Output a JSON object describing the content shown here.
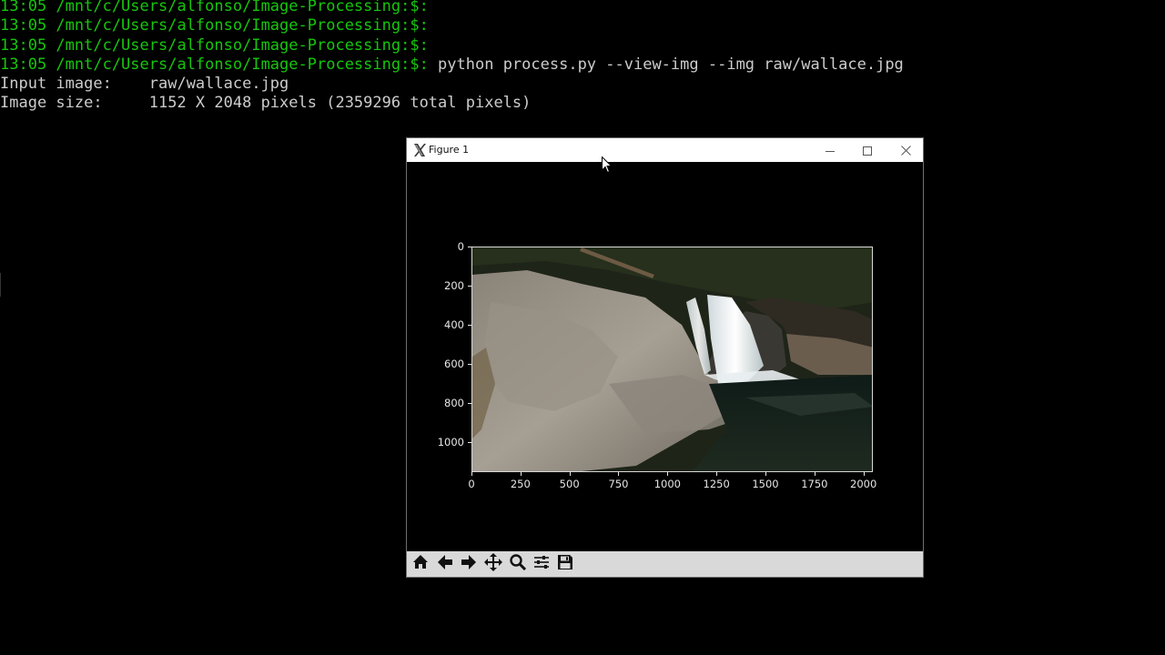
{
  "terminal": {
    "prompt": "13:05 /mnt/c/Users/alfonso/Image-Processing:$:",
    "command": " python process.py --view-img --img raw/wallace.jpg",
    "output": [
      "Input image:    raw/wallace.jpg",
      "Image size:     1152 X 2048 pixels (2359296 total pixels)"
    ]
  },
  "window": {
    "title": "Figure 1",
    "icon": "x-logo-icon",
    "controls": [
      "minimize-icon",
      "maximize-icon",
      "close-icon"
    ]
  },
  "axes": {
    "y_ticks": [
      "0",
      "200",
      "400",
      "600",
      "800",
      "1000"
    ],
    "x_ticks": [
      "0",
      "250",
      "500",
      "750",
      "1000",
      "1250",
      "1500",
      "1750",
      "2000"
    ]
  },
  "toolbar": {
    "tools": [
      "home-icon",
      "back-icon",
      "forward-icon",
      "pan-icon",
      "zoom-icon",
      "configure-subplots-icon",
      "save-icon"
    ]
  },
  "colors": {
    "prompt": "#16c60c",
    "text": "#cccccc",
    "background": "#000000",
    "toolbar": "#d9d9d9"
  }
}
